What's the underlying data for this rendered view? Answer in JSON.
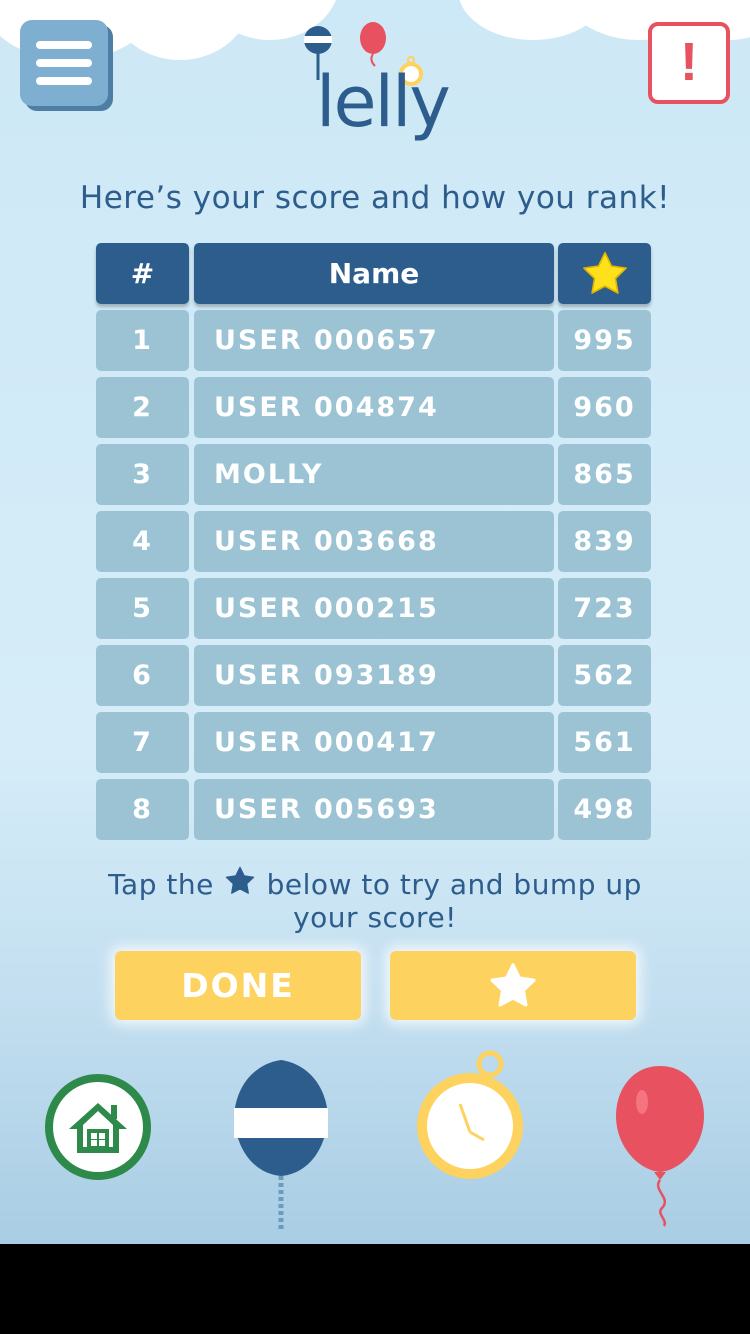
{
  "app": {
    "logo_text": "lelly"
  },
  "header": {
    "alert_label": "!"
  },
  "subtitle": "Here’s your score and how you rank!",
  "table": {
    "columns": [
      "#",
      "Name"
    ],
    "score_column_icon": "star-icon",
    "rows": [
      {
        "rank": "1",
        "name": "USER 000657",
        "score": "995"
      },
      {
        "rank": "2",
        "name": "USER 004874",
        "score": "960"
      },
      {
        "rank": "3",
        "name": "MOLLY",
        "score": "865"
      },
      {
        "rank": "4",
        "name": "USER 003668",
        "score": "839"
      },
      {
        "rank": "5",
        "name": "USER 000215",
        "score": "723"
      },
      {
        "rank": "6",
        "name": "USER 093189",
        "score": "562"
      },
      {
        "rank": "7",
        "name": "USER 000417",
        "score": "561"
      },
      {
        "rank": "8",
        "name": "USER 005693",
        "score": "498"
      }
    ]
  },
  "tip": {
    "before": "Tap the",
    "after": "below to try and bump up your score!"
  },
  "buttons": {
    "done_label": "DONE",
    "star_icon": "star-icon"
  },
  "bottom_nav": [
    "home-icon",
    "buoy-icon",
    "stopwatch-icon",
    "balloon-icon"
  ],
  "colors": {
    "primary": "#2d5d8c",
    "row": "#9bc3d4",
    "accent_yellow": "#fdd25f",
    "alert_red": "#e8515f",
    "home_green": "#2e8a4a"
  }
}
